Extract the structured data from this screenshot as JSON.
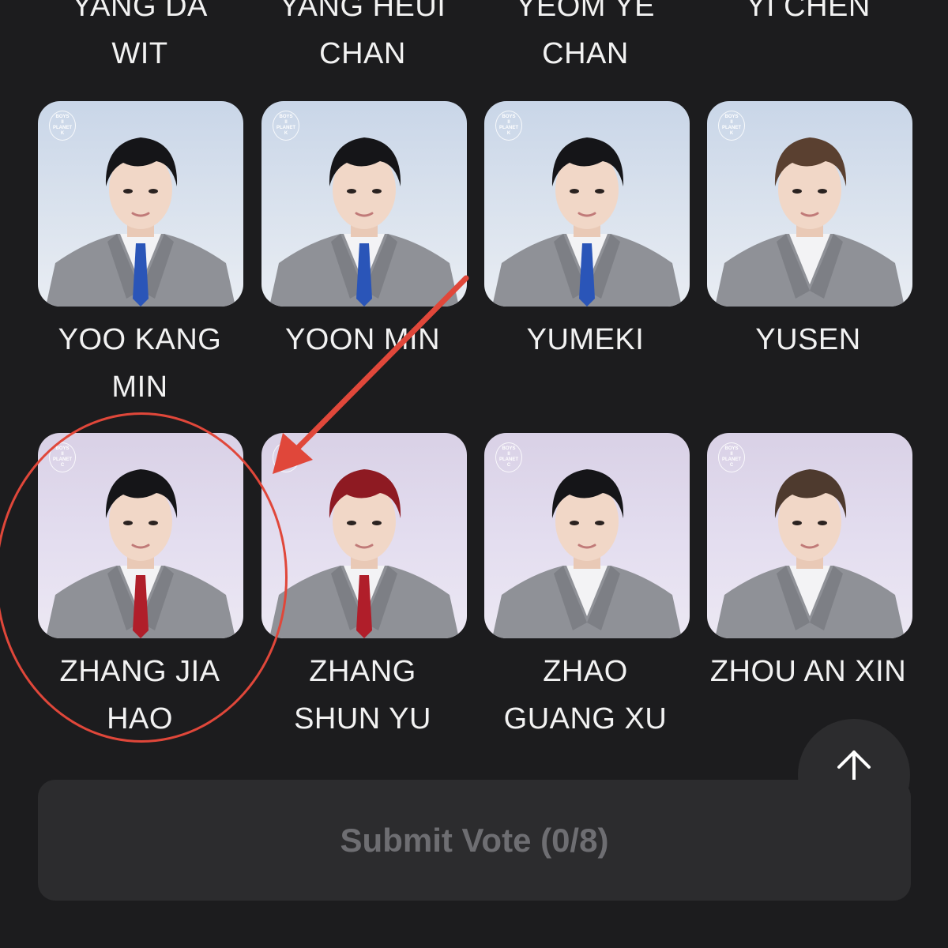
{
  "top_row": [
    {
      "name": "YANG DA\nWIT"
    },
    {
      "name": "YANG HEUI\nCHAN"
    },
    {
      "name": "YEOM YE\nCHAN"
    },
    {
      "name": "YI CHEN"
    }
  ],
  "row_b": [
    {
      "name": "YOO KANG\nMIN",
      "badge": [
        "BOYS",
        "II",
        "PLANET",
        "K"
      ],
      "tie_color": "#2a55b8",
      "hair_color": "#151518"
    },
    {
      "name": "YOON MIN",
      "badge": [
        "BOYS",
        "II",
        "PLANET",
        "K"
      ],
      "tie_color": "#2a55b8",
      "hair_color": "#151518"
    },
    {
      "name": "YUMEKI",
      "badge": [
        "BOYS",
        "II",
        "PLANET",
        "K"
      ],
      "tie_color": "#2a55b8",
      "hair_color": "#151518"
    },
    {
      "name": "YUSEN",
      "badge": [
        "BOYS",
        "II",
        "PLANET",
        "K"
      ],
      "tie_color": "",
      "hair_color": "#5a4030"
    }
  ],
  "row_c": [
    {
      "name": "ZHANG JIA\nHAO",
      "badge": [
        "BOYS",
        "II",
        "PLANET",
        "C"
      ],
      "tie_color": "#b01e2a",
      "hair_color": "#151518"
    },
    {
      "name": "ZHANG\nSHUN YU",
      "badge": [
        "BOYS",
        "II",
        "PLANET",
        "C"
      ],
      "tie_color": "#b01e2a",
      "hair_color": "#8e1a22"
    },
    {
      "name": "ZHAO\nGUANG XU",
      "badge": [
        "BOYS",
        "II",
        "PLANET",
        "C"
      ],
      "tie_color": "",
      "hair_color": "#151518"
    },
    {
      "name": "ZHOU AN XIN",
      "badge": [
        "BOYS",
        "II",
        "PLANET",
        "C"
      ],
      "tie_color": "",
      "hair_color": "#4e3a2e"
    }
  ],
  "scroll_top": {
    "icon": "arrow-up-icon"
  },
  "submit": {
    "label": "Submit Vote (0/8)"
  },
  "annotation": {
    "circle_color": "#e0473a",
    "arrow_color": "#e0473a"
  }
}
